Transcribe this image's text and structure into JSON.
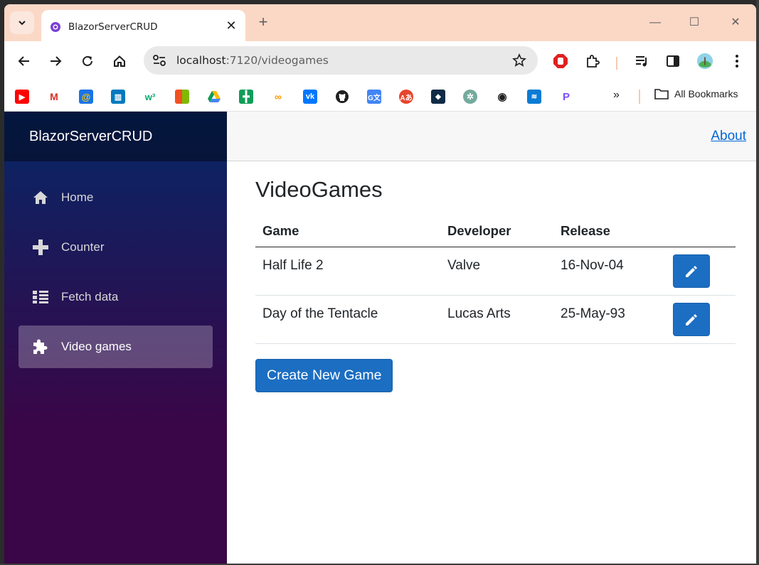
{
  "browser": {
    "tab_title": "BlazorServerCRUD",
    "url_host": "localhost",
    "url_rest": ":7120/videogames",
    "bookmarks_all_label": "All Bookmarks",
    "more_label": "»"
  },
  "app": {
    "brand": "BlazorServerCRUD",
    "about_label": "About",
    "nav": [
      {
        "label": "Home",
        "icon": "home-icon"
      },
      {
        "label": "Counter",
        "icon": "plus-icon"
      },
      {
        "label": "Fetch data",
        "icon": "list-icon"
      },
      {
        "label": "Video games",
        "icon": "puzzle-icon",
        "active": true
      }
    ]
  },
  "page": {
    "title": "VideoGames",
    "columns": [
      "Game",
      "Developer",
      "Release"
    ],
    "rows": [
      {
        "game": "Half Life 2",
        "developer": "Valve",
        "release": "16-Nov-04"
      },
      {
        "game": "Day of the Tentacle",
        "developer": "Lucas Arts",
        "release": "25-May-93"
      }
    ],
    "create_label": "Create New Game"
  },
  "colors": {
    "accent": "#1b6ec2",
    "sidebar_top": "#052767",
    "sidebar_bottom": "#3a0647",
    "tabstrip": "#fbd8c6"
  }
}
